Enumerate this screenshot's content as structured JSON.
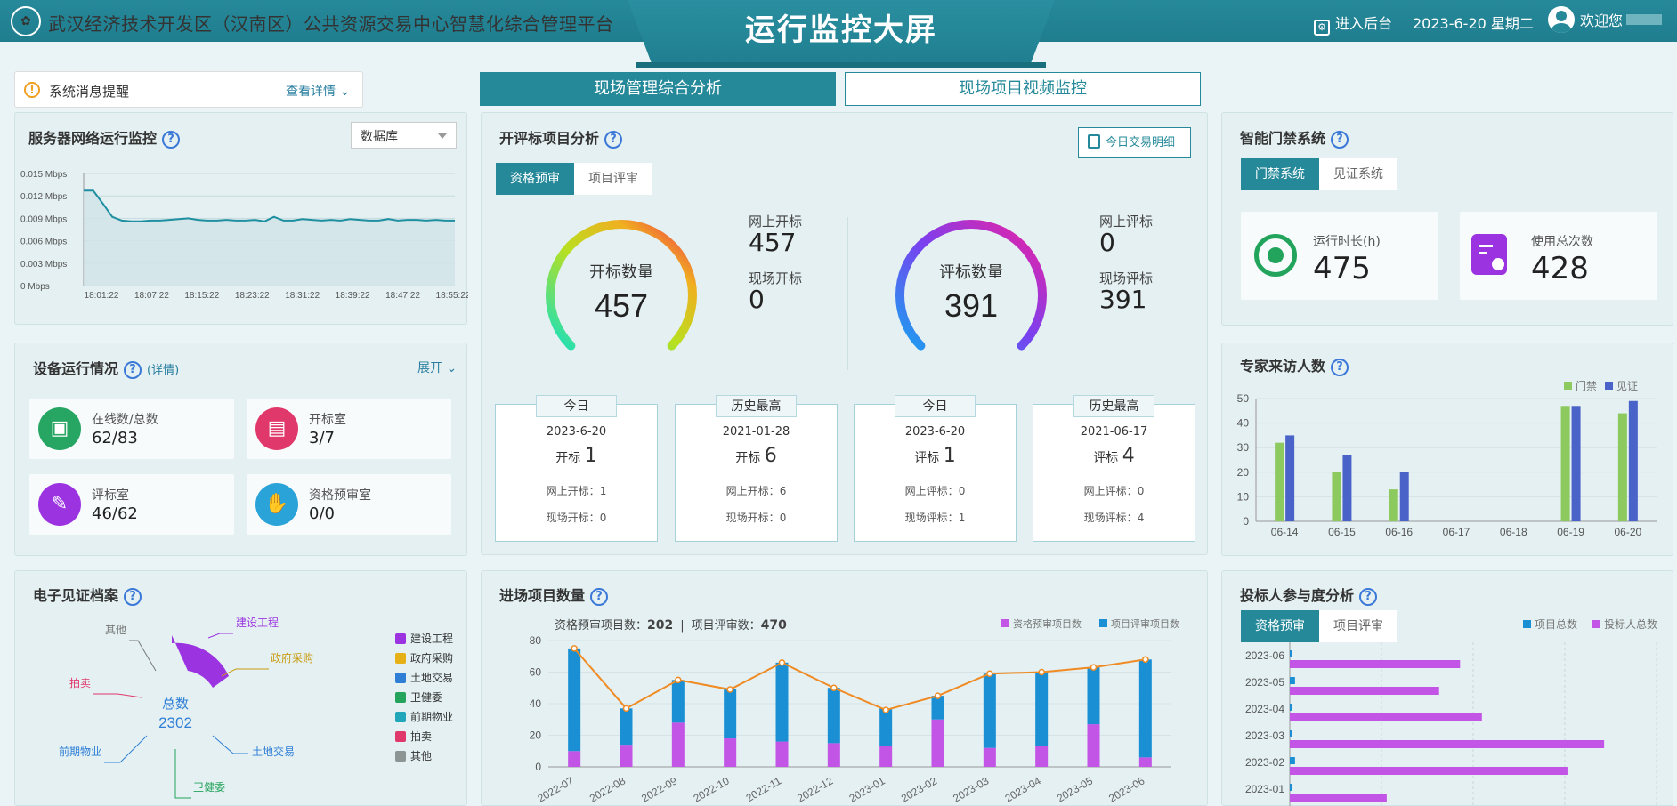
{
  "header": {
    "platform_title": "武汉经济技术开发区（汉南区）公共资源交易中心智慧化综合管理平台",
    "screen_title": "运行监控大屏",
    "admin_label": "进入后台",
    "date": "2023-6-20 星期二",
    "welcome": "欢迎您"
  },
  "main_tabs": [
    "现场管理综合分析",
    "现场项目视频监控"
  ],
  "notice": {
    "title": "系统消息提醒",
    "detail": "查看详情"
  },
  "server": {
    "title": "服务器网络运行监控",
    "select_value": "数据库",
    "chart_data": {
      "type": "area",
      "yunit": "Mbps",
      "yticks": [
        0.015,
        0.012,
        0.009,
        0.006,
        0.003,
        0
      ],
      "xticks": [
        "18:01:22",
        "18:07:22",
        "18:15:22",
        "18:23:22",
        "18:31:22",
        "18:39:22",
        "18:47:22",
        "18:55:22"
      ],
      "ylim": [
        0,
        0.015
      ],
      "y": [
        0.0127,
        0.0127,
        0.011,
        0.0092,
        0.0087,
        0.0086,
        0.0086,
        0.0087,
        0.0087,
        0.0088,
        0.0089,
        0.009,
        0.0088,
        0.0087,
        0.0087,
        0.0088,
        0.0087,
        0.0087,
        0.0088,
        0.0086,
        0.0092,
        0.0087,
        0.0087,
        0.0089,
        0.0088,
        0.0087,
        0.0088,
        0.0087,
        0.0089,
        0.0088,
        0.0087,
        0.0087,
        0.0089,
        0.0087,
        0.0088,
        0.0088,
        0.0087,
        0.0088,
        0.0087,
        0.0087
      ]
    }
  },
  "device": {
    "title": "设备运行情况",
    "detail": "(详情)",
    "expand": "展开",
    "items": [
      {
        "label": "在线数/总数",
        "value": "62/83",
        "color": "#27a563"
      },
      {
        "label": "开标室",
        "value": "3/7",
        "color": "#e0386b"
      },
      {
        "label": "评标室",
        "value": "46/62",
        "color": "#9b34e0"
      },
      {
        "label": "资格预审室",
        "value": "0/0",
        "color": "#2aa3d8"
      }
    ]
  },
  "archive": {
    "title": "电子见证档案",
    "total_label": "总数",
    "total": "2302",
    "labels": [
      "建设工程",
      "政府采购",
      "土地交易",
      "卫健委",
      "前期物业",
      "拍卖",
      "其他"
    ],
    "colors": [
      "#9b34e0",
      "#e6b116",
      "#2f7fd6",
      "#23a35c",
      "#22a7ba",
      "#e0386b",
      "#8c9494"
    ],
    "label_colors": [
      "#9b34e0",
      "#c99c12",
      "#2f7fd6",
      "#23a35c",
      "#2f7fd6",
      "#e0386b",
      "#777777"
    ]
  },
  "bid": {
    "title": "开评标项目分析",
    "detail_btn": "今日交易明细",
    "tabs": [
      "资格预审",
      "项目评审"
    ],
    "gauge1": {
      "label": "开标数量",
      "value": "457"
    },
    "gauge2": {
      "label": "评标数量",
      "value": "391"
    },
    "side1": [
      {
        "label": "网上开标",
        "value": "457"
      },
      {
        "label": "现场开标",
        "value": "0"
      }
    ],
    "side2": [
      {
        "label": "网上评标",
        "value": "0"
      },
      {
        "label": "现场评标",
        "value": "391"
      }
    ],
    "boxes": [
      {
        "tag": "今日",
        "date": "2023-6-20",
        "kind": "开标",
        "num": "1",
        "r1": "网上开标：",
        "v1": "1",
        "r2": "现场开标：",
        "v2": "0"
      },
      {
        "tag": "历史最高",
        "date": "2021-01-28",
        "kind": "开标",
        "num": "6",
        "r1": "网上开标：",
        "v1": "6",
        "r2": "现场开标：",
        "v2": "0"
      },
      {
        "tag": "今日",
        "date": "2023-6-20",
        "kind": "评标",
        "num": "1",
        "r1": "网上评标：",
        "v1": "0",
        "r2": "现场评标：",
        "v2": "1"
      },
      {
        "tag": "历史最高",
        "date": "2021-06-17",
        "kind": "评标",
        "num": "4",
        "r1": "网上评标：",
        "v1": "0",
        "r2": "现场评标：",
        "v2": "4"
      }
    ]
  },
  "entry": {
    "title": "进场项目数量",
    "sum1_label": "资格预审项目数：",
    "sum1": "202",
    "sum2_label": "项目评审数：",
    "sum2": "470",
    "chart_data": {
      "type": "bar",
      "categories": [
        "2022-07",
        "2022-08",
        "2022-09",
        "2022-10",
        "2022-11",
        "2022-12",
        "2023-01",
        "2023-02",
        "2023-03",
        "2023-04",
        "2023-05",
        "2023-06"
      ],
      "series": [
        {
          "name": "资格预审项目数",
          "values": [
            10,
            14,
            28,
            18,
            16,
            15,
            13,
            30,
            12,
            13,
            27,
            6
          ]
        },
        {
          "name": "项目评审项目数",
          "values": [
            65,
            23,
            27,
            31,
            50,
            35,
            24,
            15,
            47,
            47,
            36,
            62
          ]
        }
      ],
      "line": [
        75,
        37,
        55,
        49,
        66,
        50,
        36,
        45,
        59,
        60,
        63,
        68
      ],
      "ylim": [
        0,
        80
      ],
      "yticks": [
        0,
        20,
        40,
        60,
        80
      ],
      "colors": [
        "#c255e6",
        "#1a8fd4",
        "#f08a22"
      ]
    }
  },
  "access": {
    "title": "智能门禁系统",
    "tabs": [
      "门禁系统",
      "见证系统"
    ],
    "cards": [
      {
        "label": "运行时长(h)",
        "value": "475"
      },
      {
        "label": "使用总次数",
        "value": "428"
      }
    ]
  },
  "expert": {
    "title": "专家来访人数",
    "chart_data": {
      "type": "bar",
      "categories": [
        "06-14",
        "06-15",
        "06-16",
        "06-17",
        "06-18",
        "06-19",
        "06-20"
      ],
      "series": [
        {
          "name": "门禁",
          "values": [
            32,
            20,
            13,
            0,
            0,
            47,
            44
          ]
        },
        {
          "name": "见证",
          "values": [
            35,
            27,
            20,
            0,
            0,
            47,
            49
          ]
        }
      ],
      "ylim": [
        0,
        50
      ],
      "yticks": [
        0,
        10,
        20,
        30,
        40,
        50
      ],
      "colors": [
        "#8cc95f",
        "#4a63c8"
      ]
    }
  },
  "bidder": {
    "title": "投标人参与度分析",
    "tabs": [
      "资格预审",
      "项目评审"
    ],
    "chart_data": {
      "type": "bar",
      "orientation": "horizontal",
      "categories": [
        "2023-06",
        "2023-05",
        "2023-04",
        "2023-03",
        "2023-02",
        "2023-01"
      ],
      "series": [
        {
          "name": "项目总数",
          "values": [
            1,
            6,
            2,
            2,
            6,
            2
          ]
        },
        {
          "name": "投标人总数",
          "values": [
            195,
            171,
            220,
            360,
            318,
            111
          ]
        }
      ],
      "xlim": [
        0,
        420
      ],
      "colors": [
        "#1a8fd4",
        "#c255e6"
      ]
    }
  }
}
